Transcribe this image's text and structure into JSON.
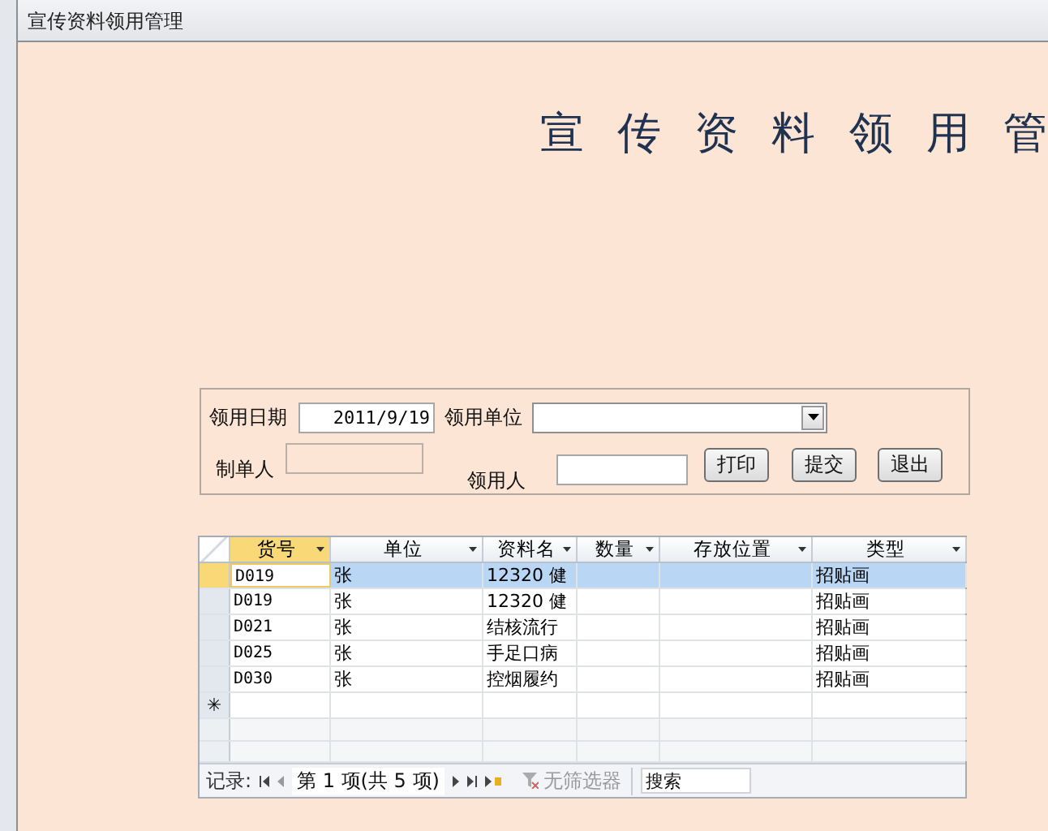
{
  "window": {
    "title": "宣传资料领用管理"
  },
  "heading": "宣 传 资 料 领 用 管",
  "form": {
    "date_label": "领用日期",
    "date_value": "2011/9/19",
    "unit_label": "领用单位",
    "maker_label": "制单人",
    "maker_disabled": true,
    "receiver_label": "领用人",
    "buttons": [
      "打印",
      "提交",
      "退出"
    ]
  },
  "table": {
    "columns": [
      "货号",
      "单位",
      "资料名",
      "数量",
      "存放位置",
      "类型"
    ],
    "rows": [
      {
        "cells": [
          "D019",
          "张",
          "12320 健",
          "",
          "",
          "招贴画"
        ],
        "selected": true
      },
      {
        "cells": [
          "D019",
          "张",
          "12320 健",
          "",
          "",
          "招贴画"
        ],
        "selected": false
      },
      {
        "cells": [
          "D021",
          "张",
          "结核流行",
          "",
          "",
          "招贴画"
        ],
        "selected": false
      },
      {
        "cells": [
          "D025",
          "张",
          "手足口病",
          "",
          "",
          "招贴画"
        ],
        "selected": false
      },
      {
        "cells": [
          "D030",
          "张",
          "控烟履约",
          "",
          "",
          "招贴画"
        ],
        "selected": false
      }
    ],
    "new_row_marker": "✳"
  },
  "navigator": {
    "label": "记录:",
    "position": "第 1 项(共 5 项)",
    "filter": "无筛选器",
    "search_placeholder": "搜索"
  }
}
